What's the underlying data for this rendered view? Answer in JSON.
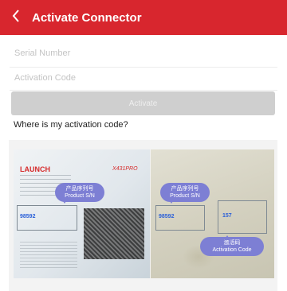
{
  "header": {
    "title": "Activate Connector",
    "back_icon": "chevron-left-icon"
  },
  "form": {
    "serial_placeholder": "Serial Number",
    "code_placeholder": "Activation Code",
    "activate_label": "Activate"
  },
  "help": {
    "text": "Where is my activation code?"
  },
  "image": {
    "left": {
      "brand": "LAUNCH",
      "brand_sub": "X431PRO",
      "sn_value": "98592",
      "bubble_zh": "产品序列号",
      "bubble_en": "Product S/N"
    },
    "right": {
      "sn_value": "98592",
      "code_value": "157",
      "sn_bubble_zh": "产品序列号",
      "sn_bubble_en": "Product S/N",
      "code_bubble_zh": "激活码",
      "code_bubble_en": "Activation Code"
    }
  },
  "colors": {
    "header": "#d8262e",
    "button": "#cfcfcf",
    "bubble": "#7d7fd4"
  }
}
